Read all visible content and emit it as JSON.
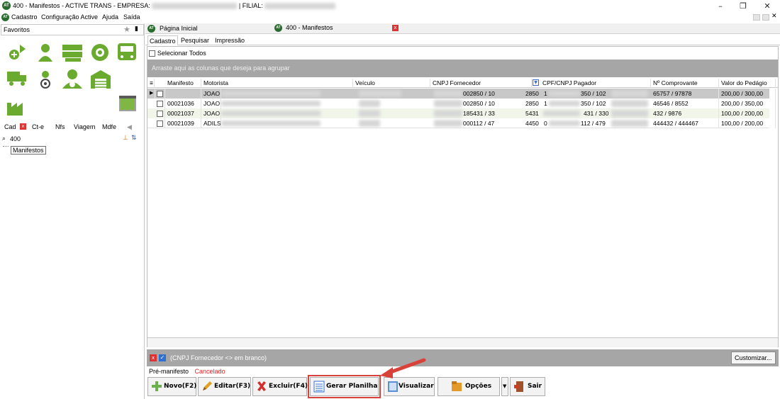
{
  "window": {
    "title_prefix": "400 - Manifestos - ACTIVE TRANS - EMPRESA: ",
    "filial_label": "| FILIAL: ",
    "app_icon_text": "AT"
  },
  "menu": [
    "Cadastro",
    "Configuração Active",
    "Ajuda",
    "Saída"
  ],
  "left": {
    "favorites_label": "Favoritos",
    "tabs": [
      "Cad",
      "Ct-e",
      "Nfs",
      "Viagem",
      "Mdfe"
    ],
    "search_value": "400",
    "tree_item": "Manifestos"
  },
  "doc_tabs": [
    "Página Inicial",
    "400 - Manifestos"
  ],
  "inner_tabs": [
    "Cadastro",
    "Pesquisar",
    "Impressão"
  ],
  "grid": {
    "select_all": "Selecionar Todos",
    "group_hint": "Arraste aqui as colunas que deseja para agrupar",
    "columns": [
      "Manifesto",
      "Motorista",
      "Veículo",
      "CNPJ Fornecedor",
      "CPF/CNPJ Pagador",
      "Nº Comprovante",
      "Valor do Pedágio"
    ],
    "rows": [
      {
        "manifesto": "",
        "motorista": "JOAO",
        "cnpj_a": "002850 / 10",
        "cnpj_b": "2850",
        "cpf_a": "1",
        "cpf_b": "350 / 102",
        "comprovante": "65757 / 97878",
        "valor": "200,00 / 300,00"
      },
      {
        "manifesto": "00021036",
        "motorista": "JOAO",
        "cnpj_a": "002850 / 10",
        "cnpj_b": "2850",
        "cpf_a": "1",
        "cpf_b": "350 / 102",
        "comprovante": "46546 / 8552",
        "valor": "200,00 / 350,00"
      },
      {
        "manifesto": "00021037",
        "motorista": "JOAO",
        "cnpj_a": "185431 / 33",
        "cnpj_b": "5431",
        "cpf_a": "",
        "cpf_b": "431 / 330",
        "comprovante": "432 / 9876",
        "valor": "100,00 / 200,00"
      },
      {
        "manifesto": "00021039",
        "motorista": "ADILS",
        "cnpj_a": "000112 / 47",
        "cnpj_b": "4450",
        "cpf_a": "0",
        "cpf_b": "112 / 479",
        "comprovante": "444432 / 444467",
        "valor": "100,00 / 200,00"
      }
    ]
  },
  "filter": {
    "text": "(CNPJ Fornecedor <> em branco)",
    "customize_label": "Customizar..."
  },
  "status": {
    "pre_manifesto": "Pré-manifesto",
    "cancelado": "Cancelado",
    "cancelado_color": "#e02020"
  },
  "buttons": {
    "novo": "Novo(F2)",
    "editar": "Editar(F3)",
    "excluir": "Excluir(F4)",
    "gerar": "Gerar Planilha",
    "visualizar": "Visualizar",
    "opcoes": "Opções",
    "sair": "Sair"
  },
  "colors": {
    "accent_green": "#6aaa2e",
    "highlight_red": "#d9423a"
  }
}
